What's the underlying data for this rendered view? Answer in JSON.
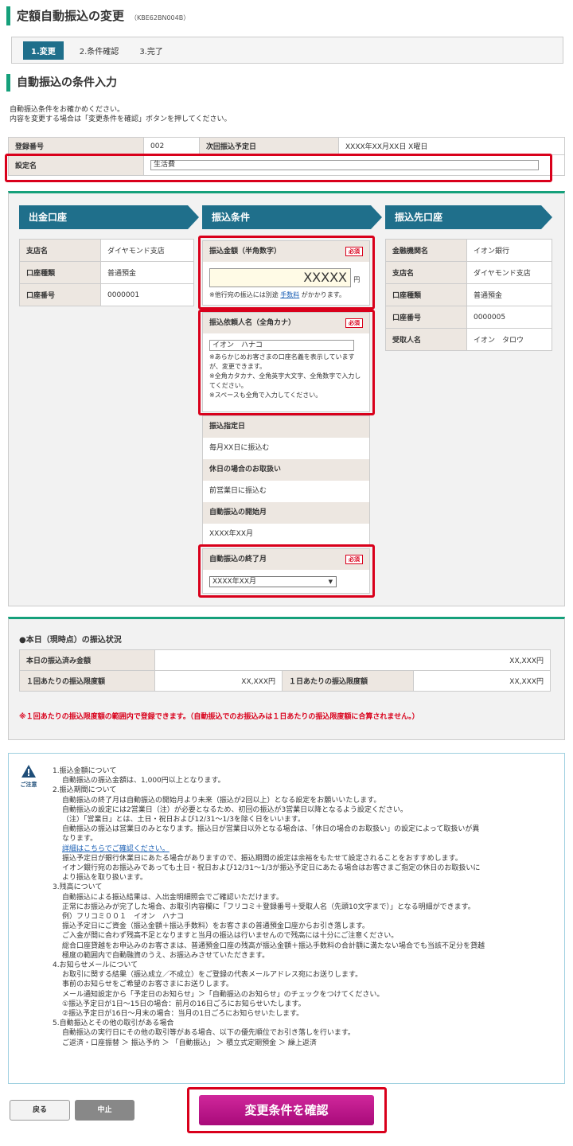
{
  "page": {
    "title": "定額自動振込の変更",
    "code": "（KBE62BN004B）"
  },
  "steps": [
    "1.変更",
    "2.条件確認",
    "3.完了"
  ],
  "section_title": "自動振込の条件入力",
  "intro": [
    "自動振込条件をお確かめください。",
    "内容を変更する場合は「変更条件を確認」ボタンを押してください。"
  ],
  "registration": {
    "label_no": "登録番号",
    "value_no": "002",
    "label_next": "次回振込予定日",
    "value_next": "XXXX年XX月XX日 X曜日",
    "label_name": "設定名",
    "value_name": "生活費"
  },
  "headers": {
    "from": "出金口座",
    "cond": "振込条件",
    "to": "振込先口座"
  },
  "from_account": [
    [
      "支店名",
      "ダイヤモンド支店"
    ],
    [
      "口座種類",
      "普通預金"
    ],
    [
      "口座番号",
      "0000001"
    ]
  ],
  "to_account": [
    [
      "金融機関名",
      "イオン銀行"
    ],
    [
      "支店名",
      "ダイヤモンド支店"
    ],
    [
      "口座種類",
      "普通預金"
    ],
    [
      "口座番号",
      "0000005"
    ],
    [
      "受取人名",
      "イオン　タロウ"
    ]
  ],
  "required": "必須",
  "amount": {
    "label": "振込金額（半角数字）",
    "value": "XXXXX",
    "unit": "円",
    "note_pre": "※他行宛の振込には別途",
    "note_link": "手数料",
    "note_post": "がかかります。"
  },
  "requester": {
    "label": "振込依頼人名（全角カナ）",
    "value": "イオン　ハナコ",
    "notes": [
      "※あらかじめお客さまの口座名義を表示していますが、変更できます。",
      "※全角カタカナ、全角英字大文字、全角数字で入力してください。",
      "※スペースも全角で入力してください。"
    ]
  },
  "fixed": [
    {
      "label": "振込指定日",
      "value": "毎月XX日に振込む"
    },
    {
      "label": "休日の場合のお取扱い",
      "value": "前営業日に振込む"
    },
    {
      "label": "自動振込の開始月",
      "value": "XXXX年XX月"
    }
  ],
  "end_month": {
    "label": "自動振込の終了月",
    "value": "XXXX年XX月"
  },
  "status": {
    "title": "●本日（現時点）の振込状況",
    "today_label": "本日の振込済み金額",
    "today_value": "XX,XXX円",
    "per_label": "１回あたりの振込限度額",
    "per_value": "XX,XXX円",
    "day_label": "１日あたりの振込限度額",
    "day_value": "XX,XXX円",
    "warning": "※１回あたりの振込限度額の範囲内で登録できます。（自動振込でのお振込みは１日あたりの振込限度額に合算されません。）"
  },
  "caution": {
    "icon_label": "ご注意",
    "lines": [
      [
        "1.振込金額について",
        0
      ],
      [
        "自動振込の振込金額は、1,000円以上となります。",
        1
      ],
      [
        "2.振込期間について",
        0
      ],
      [
        "自動振込の終了月は自動振込の開始月より未来（振込が2回以上）となる設定をお願いいたします。",
        1
      ],
      [
        "自動振込の設定には2営業日（注）が必要となるため、初回の振込が3営業日以降となるよう設定ください。",
        1
      ],
      [
        "（注）「営業日」とは、土日・祝日および12/31～1/3を除く日をいいます。",
        1
      ],
      [
        "自動振込の振込は営業日のみとなります。振込日が営業日以外となる場合は、「休日の場合のお取扱い」の設定によって取扱いが異",
        1
      ],
      [
        "なります。",
        1
      ],
      [
        "詳細はこちらでご確認ください。",
        2
      ],
      [
        "振込予定日が銀行休業日にあたる場合がありますので、振込期間の設定は余裕をもたせて設定されることをおすすめします。",
        1
      ],
      [
        "イオン銀行宛のお振込みであっても土日・祝日および12/31～1/3が振込予定日にあたる場合はお客さまご指定の休日のお取扱いに",
        1
      ],
      [
        "より振込を取り扱います。",
        1
      ],
      [
        "3.残高について",
        0
      ],
      [
        "自動振込による振込結果は、入出金明細照会でご確認いただけます。",
        1
      ],
      [
        "正常にお振込みが完了した場合、お取引内容欄に「フリコミ＋登録番号＋受取人名（先頭10文字まで）」となる明細ができます。",
        1
      ],
      [
        "例）フリコミ００１　イオン　ハナコ",
        1
      ],
      [
        "振込予定日にご資金（振込金額＋振込手数料）をお客さまの普通預金口座からお引き落します。",
        1
      ],
      [
        "ご入金が間に合わず残高不足となりますと当月の振込は行いませんので残高には十分にご注意ください。",
        1
      ],
      [
        "総合口座貸越をお申込みのお客さまは、普通預金口座の残高が振込金額＋振込手数料の合計額に満たない場合でも当該不足分を貸越",
        1
      ],
      [
        "極度の範囲内で自動融資のうえ、お振込みさせていただきます。",
        1
      ],
      [
        "4.お知らせメールについて",
        0
      ],
      [
        "お取引に関する結果（振込成立／不成立）をご登録の代表メールアドレス宛にお送りします。",
        1
      ],
      [
        "事前のお知らせをご希望のお客さまにお送りします。",
        1
      ],
      [
        "メール通知設定から「予定日のお知らせ」＞「自動振込のお知らせ」のチェックをつけてください。",
        1
      ],
      [
        "①振込予定日が1日～15日の場合：前月の16日ごろにお知らせいたします。",
        1
      ],
      [
        "②振込予定日が16日～月末の場合：当月の1日ごろにお知らせいたします。",
        1
      ],
      [
        "5.自動振込とその他の取引がある場合",
        0
      ],
      [
        "自動振込の実行日にその他の取引等がある場合、以下の優先順位でお引き落しを行います。",
        1
      ],
      [
        "ご返済・口座振替 ＞ 振込予約 ＞ 「自動振込」 ＞ 積立式定期預金 ＞ 繰上返済",
        1
      ]
    ]
  },
  "buttons": {
    "back": "戻る",
    "cancel": "中止",
    "confirm": "変更条件を確認"
  }
}
